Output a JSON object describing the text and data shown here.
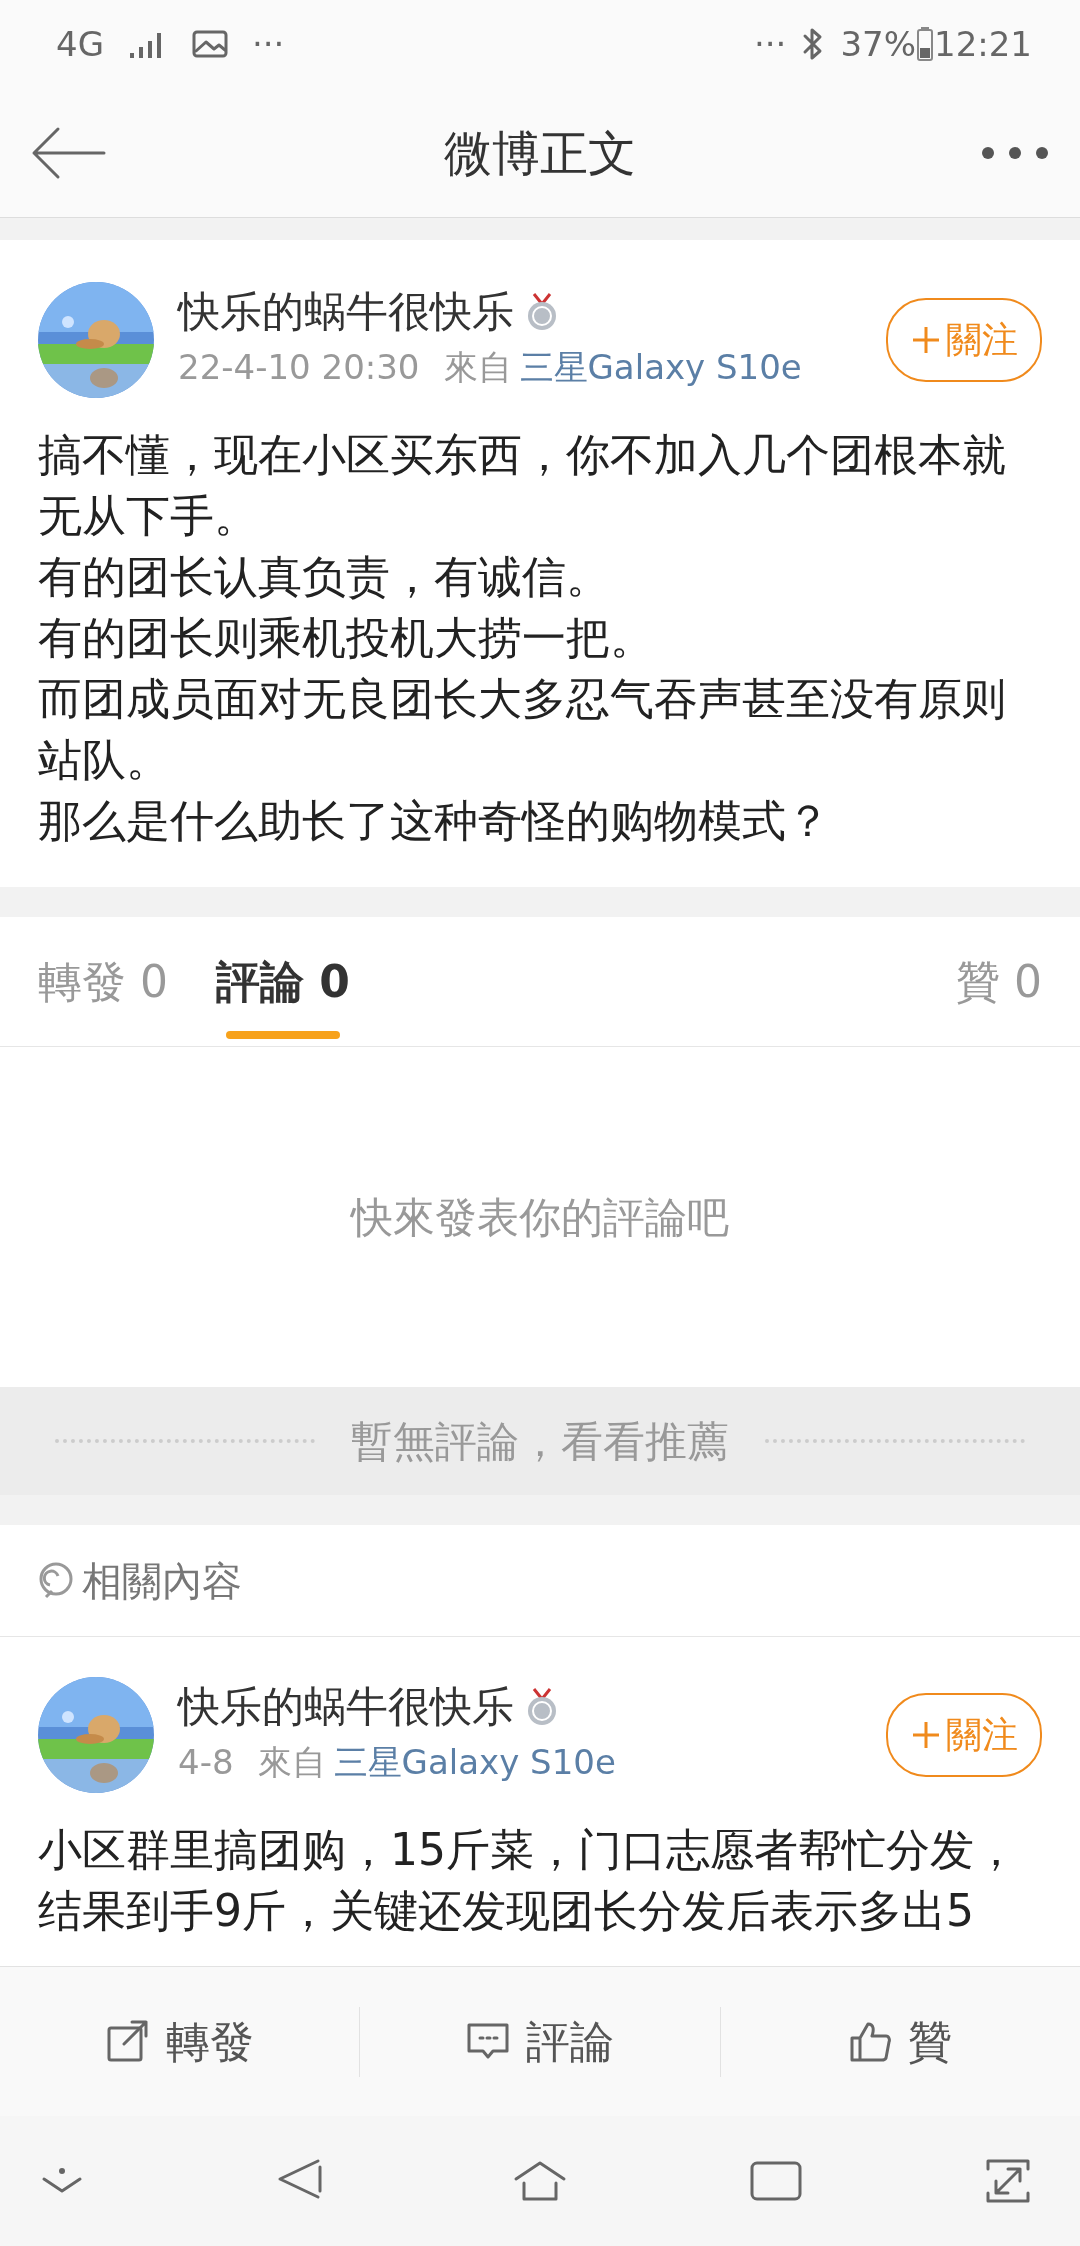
{
  "status_bar": {
    "network": "4G",
    "more_left": "···",
    "more_right": "···",
    "battery": "37%",
    "time": "12:21"
  },
  "header": {
    "title": "微博正文"
  },
  "post": {
    "author": "快乐的蜗牛很快乐",
    "date": "22-4-10 20:30",
    "source_prefix": "來自",
    "source": "三星Galaxy S10e",
    "follow": "關注",
    "body": [
      "搞不懂，现在小区买东西，你不加入几个团根本就无从下手。",
      "有的团长认真负责，有诚信。",
      "有的团长则乘机投机大捞一把。",
      "而团成员面对无良团长大多忍气吞声甚至没有原则站队。",
      "那么是什么助长了这种奇怪的购物模式？"
    ]
  },
  "tabs": [
    {
      "label": "轉發",
      "count": "0",
      "selected": false
    },
    {
      "label": "評論",
      "count": "0",
      "selected": true
    },
    {
      "label": "贊",
      "count": "0",
      "selected": false
    }
  ],
  "empty_comments": "快來發表你的評論吧",
  "no_comments_banner": "暫無評論，看看推薦",
  "related": {
    "title": "相關內容",
    "posts": [
      {
        "author": "快乐的蜗牛很快乐",
        "date": "4-8",
        "source_prefix": "來自",
        "source": "三星Galaxy S10e",
        "follow": "關注",
        "body": [
          "小区群里搞团购，15斤菜，门口志愿者帮忙分发，结果到手9斤，关键还发现团长分发后表示多出5"
        ]
      }
    ]
  },
  "actions": [
    {
      "kind": "repost",
      "label": "轉發"
    },
    {
      "kind": "comment",
      "label": "評論"
    },
    {
      "kind": "like",
      "label": "贊"
    }
  ]
}
